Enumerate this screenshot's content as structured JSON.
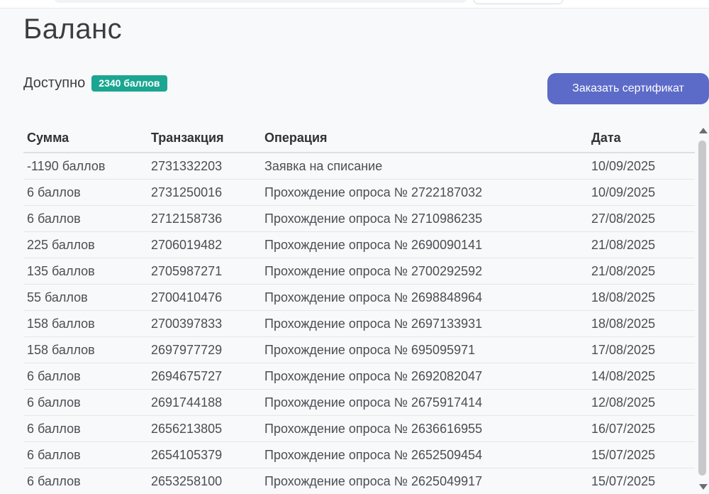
{
  "page": {
    "title": "Баланс"
  },
  "balance": {
    "available_label": "Доступно",
    "badge": "2340 баллов",
    "badge_color": "#1aa691"
  },
  "actions": {
    "order_certificate_label": "Заказать сертификат",
    "button_color": "#5c6bc8"
  },
  "table": {
    "headers": {
      "amount": "Сумма",
      "transaction": "Транзакция",
      "operation": "Операция",
      "date": "Дата"
    },
    "rows": [
      {
        "amount": "-1190 баллов",
        "transaction": "2731332203",
        "operation": "Заявка на списание",
        "date": "10/09/2025"
      },
      {
        "amount": "6 баллов",
        "transaction": "2731250016",
        "operation": "Прохождение опроса № 2722187032",
        "date": "10/09/2025"
      },
      {
        "amount": "6 баллов",
        "transaction": "2712158736",
        "operation": "Прохождение опроса № 2710986235",
        "date": "27/08/2025"
      },
      {
        "amount": "225 баллов",
        "transaction": "2706019482",
        "operation": "Прохождение опроса № 2690090141",
        "date": "21/08/2025"
      },
      {
        "amount": "135 баллов",
        "transaction": "2705987271",
        "operation": "Прохождение опроса № 2700292592",
        "date": "21/08/2025"
      },
      {
        "amount": "55 баллов",
        "transaction": "2700410476",
        "operation": "Прохождение опроса № 2698848964",
        "date": "18/08/2025"
      },
      {
        "amount": "158 баллов",
        "transaction": "2700397833",
        "operation": "Прохождение опроса № 2697133931",
        "date": "18/08/2025"
      },
      {
        "amount": "158 баллов",
        "transaction": "2697977729",
        "operation": "Прохождение опроса № 695095971",
        "date": "17/08/2025"
      },
      {
        "amount": "6 баллов",
        "transaction": "2694675727",
        "operation": "Прохождение опроса № 2692082047",
        "date": "14/08/2025"
      },
      {
        "amount": "6 баллов",
        "transaction": "2691744188",
        "operation": "Прохождение опроса № 2675917414",
        "date": "12/08/2025"
      },
      {
        "amount": "6 баллов",
        "transaction": "2656213805",
        "operation": "Прохождение опроса № 2636616955",
        "date": "16/07/2025"
      },
      {
        "amount": "6 баллов",
        "transaction": "2654105379",
        "operation": "Прохождение опроса № 2652509454",
        "date": "15/07/2025"
      },
      {
        "amount": "6 баллов",
        "transaction": "2653258100",
        "operation": "Прохождение опроса № 2625049917",
        "date": "15/07/2025"
      }
    ]
  },
  "icons": {
    "scroll_up": "scroll-up-arrow-icon",
    "scroll_down": "scroll-down-arrow-icon"
  }
}
